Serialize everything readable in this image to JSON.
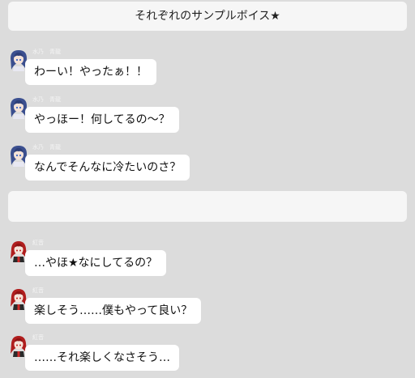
{
  "banners": {
    "top": "それぞれのサンプルボイス★",
    "middle": ""
  },
  "messages": [
    {
      "speaker": "水乃　青龍",
      "text": "わーい！やったぁ！！",
      "avatar": "mizuno-avatar-icon"
    },
    {
      "speaker": "水乃　青龍",
      "text": "やっほー！何してるの〜？",
      "avatar": "mizuno-avatar-icon"
    },
    {
      "speaker": "水乃　青龍",
      "text": "なんでそんなに冷たいのさ？",
      "avatar": "mizuno-avatar-icon"
    },
    {
      "speaker": "紅音",
      "text": "…やほ★なにしてるの？",
      "avatar": "akane-avatar-icon"
    },
    {
      "speaker": "紅音",
      "text": "楽しそう……僕もやって良い？",
      "avatar": "akane-avatar-icon"
    },
    {
      "speaker": "紅音",
      "text": "……それ楽しくなさそう…",
      "avatar": "akane-avatar-icon"
    }
  ],
  "colors": {
    "background": "#dcdcdc",
    "banner": "#f6f6f6",
    "bubble": "#ffffff",
    "mizuno_hair": "#3b4f8f",
    "akane_hair": "#b01e1e"
  }
}
